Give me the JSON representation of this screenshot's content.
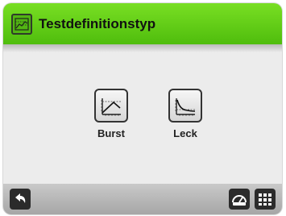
{
  "header": {
    "title": "Testdefinitionstyp",
    "icon": "chart-icon",
    "color": "#5cc715"
  },
  "tiles": [
    {
      "label": "Burst",
      "icon": "burst-curve-icon"
    },
    {
      "label": "Leck",
      "icon": "leak-decay-curve-icon"
    }
  ],
  "footer": {
    "back_icon": "back-arrow-icon",
    "gauge_icon": "gauge-icon",
    "menu_icon": "grid-menu-icon"
  }
}
